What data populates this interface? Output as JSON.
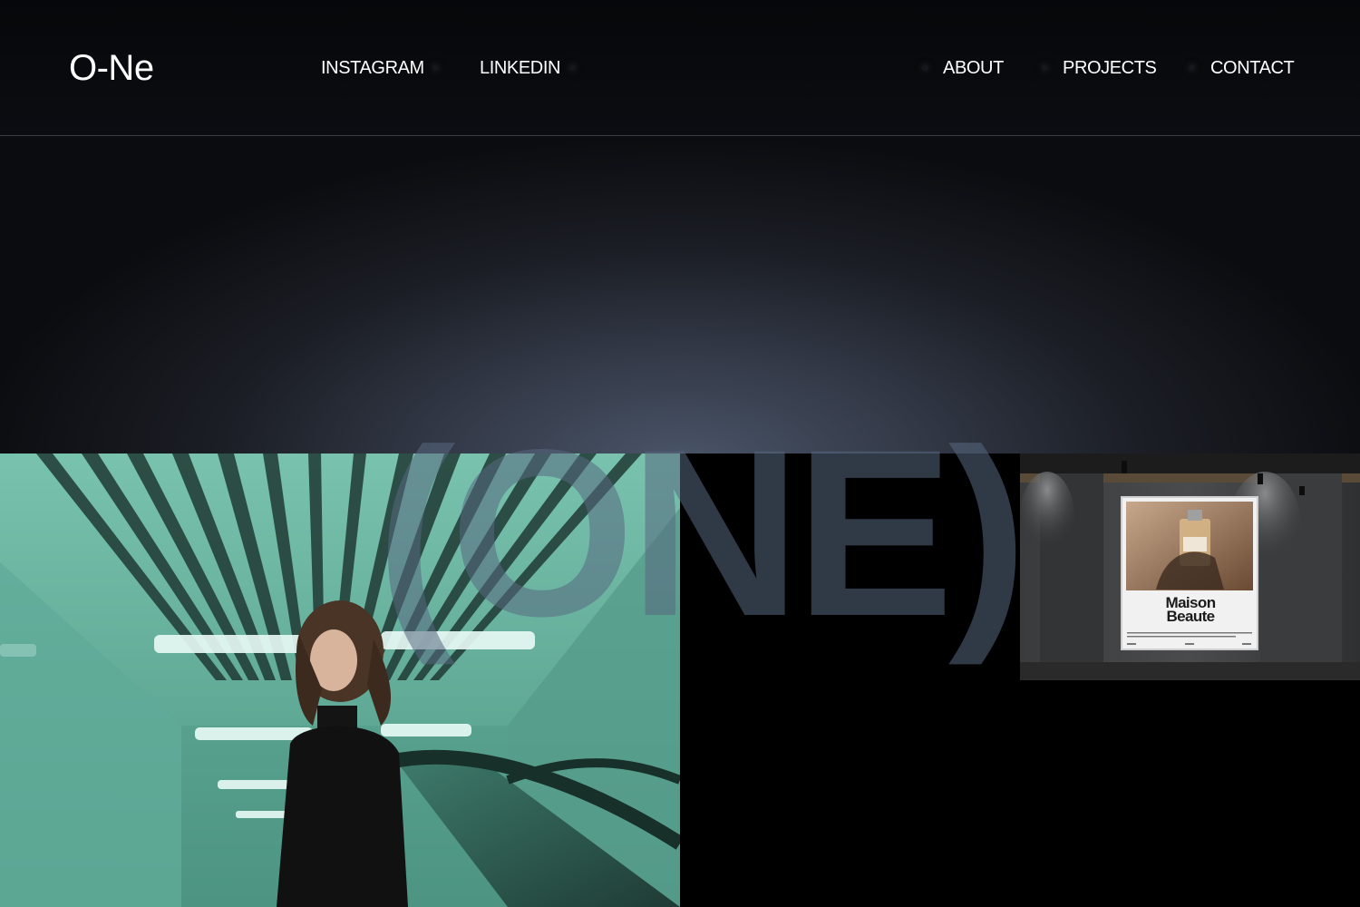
{
  "header": {
    "logo": "O-Ne",
    "nav_left": [
      {
        "label": "INSTAGRAM"
      },
      {
        "label": "LINKEDIN"
      }
    ],
    "nav_right": [
      {
        "label": "ABOUT"
      },
      {
        "label": "PROJECTS"
      },
      {
        "label": "CONTACT"
      }
    ]
  },
  "hero": {
    "word": "(ONE)"
  },
  "gallery": {
    "poster_title_line1": "Maison",
    "poster_title_line2": "Beaute"
  },
  "colors": {
    "background": "#000000",
    "header_bg": "#0b0d12",
    "hero_glow": "#4a5568",
    "text": "#ffffff"
  }
}
